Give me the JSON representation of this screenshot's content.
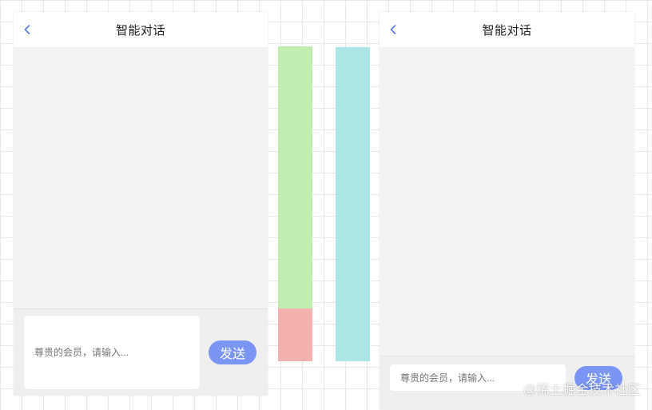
{
  "left_phone": {
    "title": "智能对话",
    "input_placeholder": "尊贵的会员，请输入...",
    "send_label": "发送"
  },
  "right_phone": {
    "title": "智能对话",
    "input_placeholder": "尊贵的会员，请输入...",
    "send_label": "发送"
  },
  "watermark": "@稀土掘金技术社区",
  "colors": {
    "accent": "#7b95f5",
    "chat_background": "#f2f3f5",
    "green_bar": "#c2edb1",
    "red_bar": "#f4b2ae",
    "cyan_bar": "#ade6e6"
  },
  "icons": {
    "back": "chevron-left-icon"
  }
}
